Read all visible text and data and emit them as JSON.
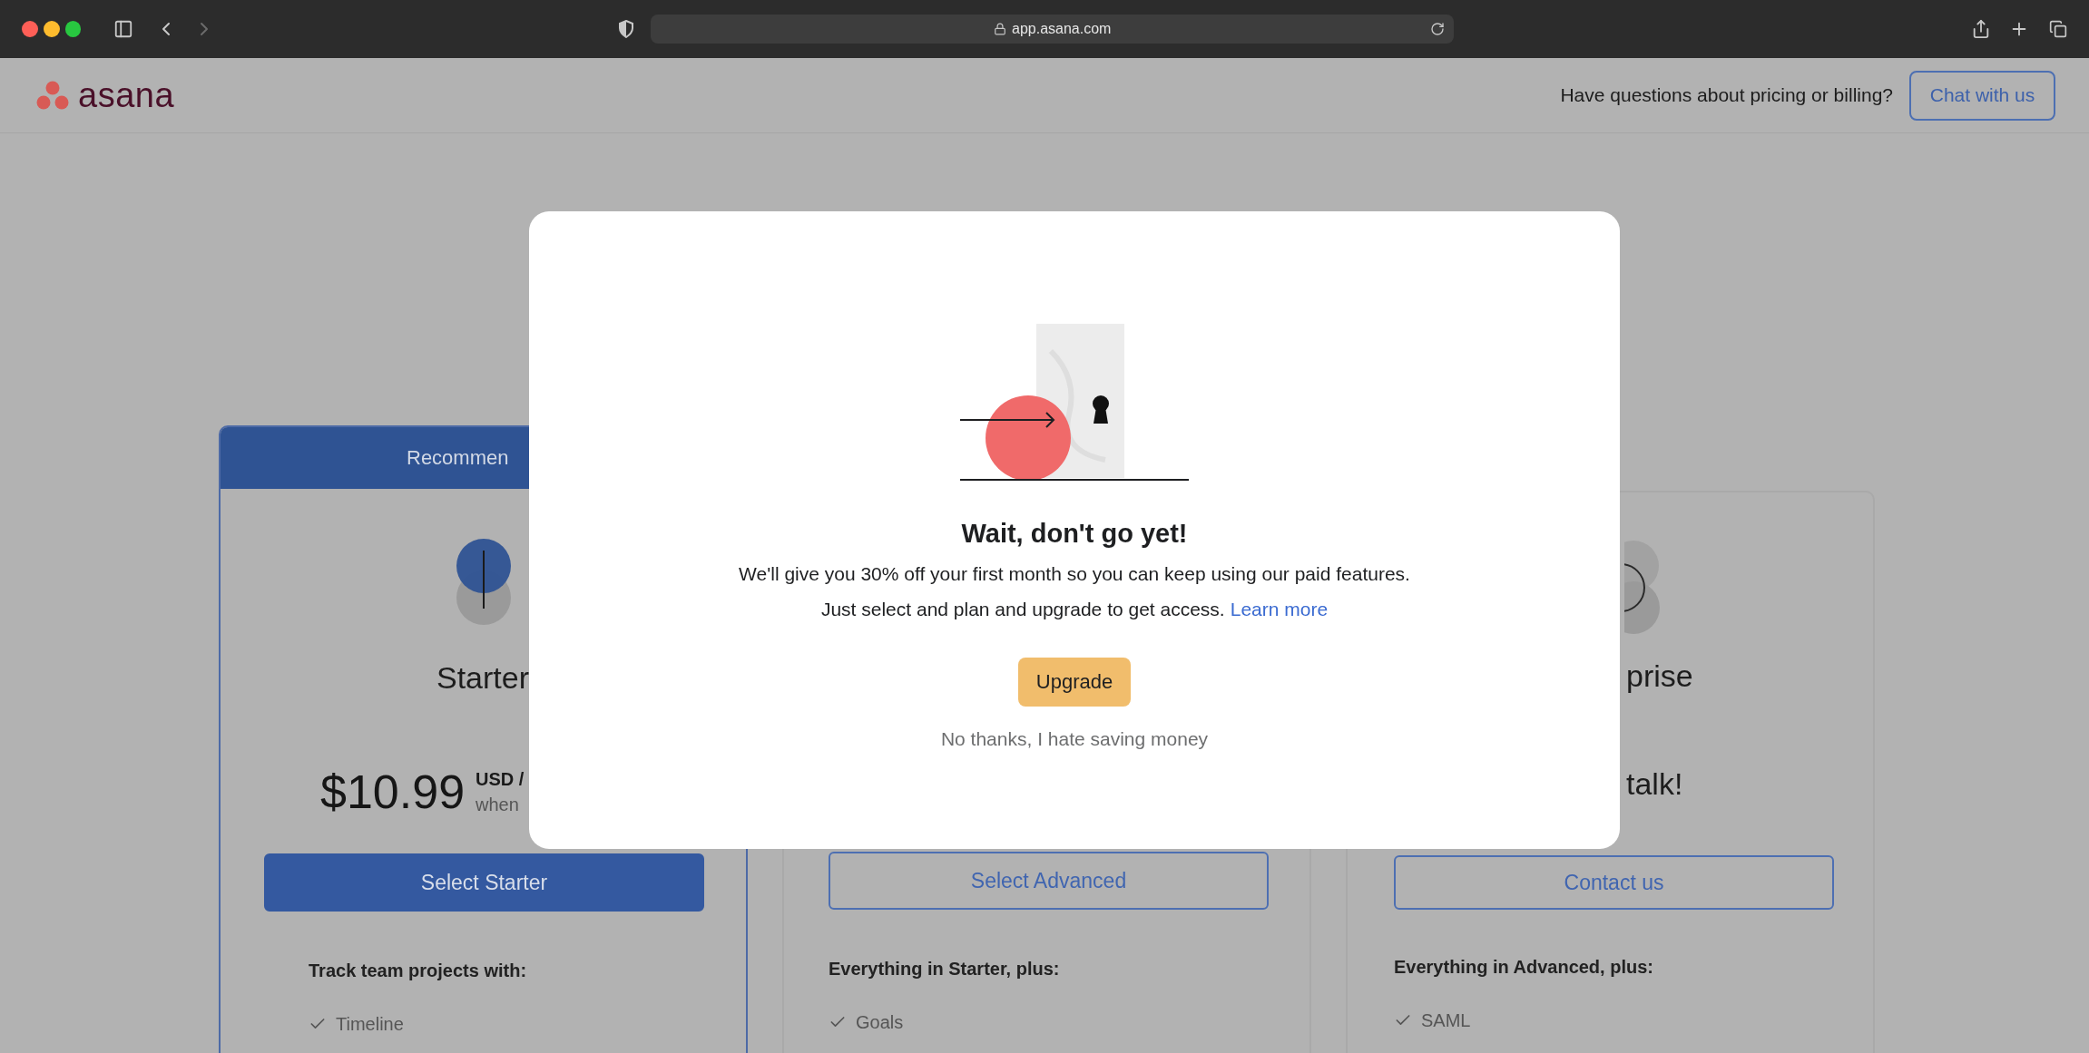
{
  "browser": {
    "url": "app.asana.com"
  },
  "header": {
    "logo": "asana",
    "question": "Have questions about pricing or billing?",
    "chat_button": "Chat with us"
  },
  "plans": [
    {
      "kind": "recommended",
      "badge": "Recommen",
      "name": "Starter",
      "price": "$10.99",
      "price_unit": "USD /",
      "price_note": "when",
      "button": "Select Starter",
      "features_heading": "Track team projects with:",
      "features": [
        "Timeline"
      ]
    },
    {
      "kind": "standard",
      "button": "Select Advanced",
      "features_heading": "Everything in Starter, plus:",
      "features": [
        "Goals"
      ]
    },
    {
      "kind": "standard",
      "name": "prise",
      "tagline": "talk!",
      "button": "Contact us",
      "features_heading": "Everything in Advanced, plus:",
      "features": [
        "SAML"
      ]
    }
  ],
  "modal": {
    "title": "Wait, don't go yet!",
    "message": "We'll give you 30% off your first month so you can keep using our paid features.",
    "note": "Just select and plan and upgrade to get access.",
    "link": "Learn more",
    "primary_button": "Upgrade",
    "dismiss": "No thanks, I hate saving money"
  }
}
